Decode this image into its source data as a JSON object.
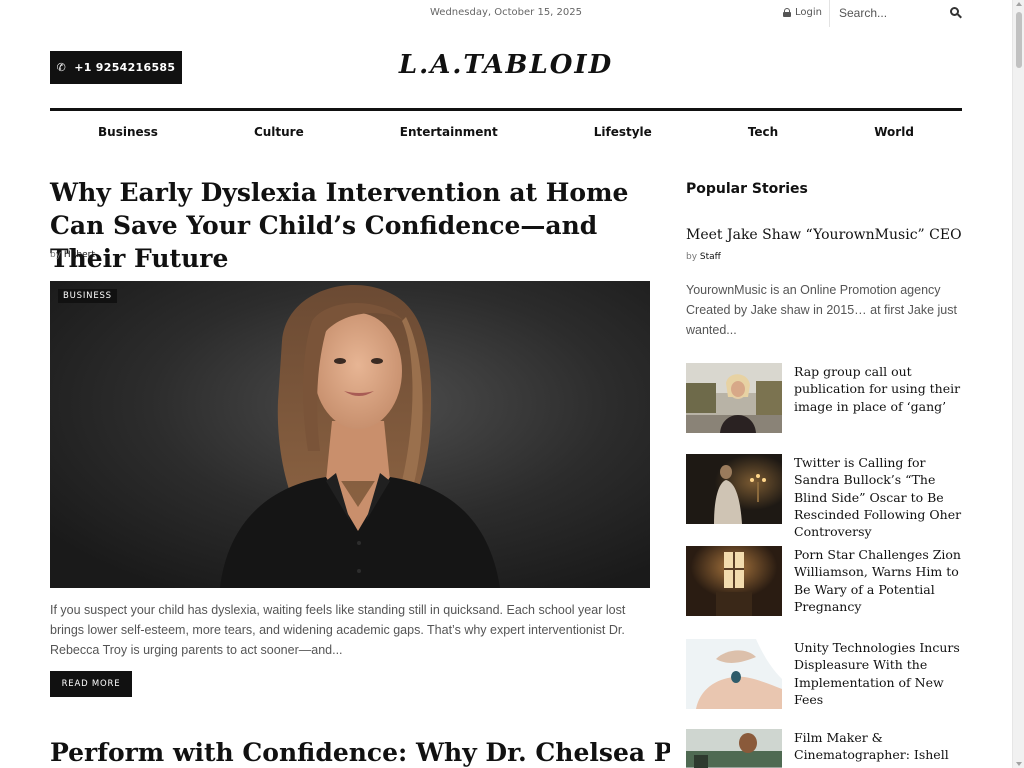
{
  "topbar": {
    "date": "Wednesday, October 15, 2025",
    "login_label": "Login",
    "search_placeholder": "Search..."
  },
  "header": {
    "phone_label": "+1 9254216585",
    "logo_text": "L.A.TABLOID"
  },
  "nav": {
    "items": [
      "Business",
      "Culture",
      "Entertainment",
      "Lifestyle",
      "Tech",
      "World"
    ]
  },
  "main": {
    "article": {
      "title": "Why Early Dyslexia Intervention at Home Can Save Your Child’s Confidence—and Their Future",
      "by_prefix": "by",
      "author": "Hubert",
      "category": "BUSINESS",
      "excerpt": "If you suspect your child has dyslexia, waiting feels like standing still in quicksand. Each school year lost brings lower self-esteem, more tears, and widening academic gaps. That’s why expert interventionist Dr. Rebecca Troy is urging parents to act sooner—and...",
      "read_more": "READ MORE"
    },
    "next_article_title": "Perform with Confidence: Why Dr. Chelsea Pierotti’s"
  },
  "sidebar": {
    "title": "Popular Stories",
    "featured": {
      "title": "Meet Jake Shaw “YourownMusic” CEO",
      "by_prefix": "by",
      "author": "Staff",
      "excerpt": "YourownMusic is an Online Promotion agency Created by Jake shaw in 2015… at first Jake just wanted..."
    },
    "stories": [
      {
        "title": "Rap group call out publication for using their image in place of ‘gang’"
      },
      {
        "title": "Twitter is Calling for Sandra Bullock’s “The Blind Side” Oscar to Be Rescinded Following Oher Controversy"
      },
      {
        "title": "Porn Star Challenges Zion Williamson, Warns Him to Be Wary of a Potential Pregnancy"
      },
      {
        "title": "Unity Technologies Incurs Displeasure With the Implementation of New Fees"
      },
      {
        "title": "Film Maker & Cinematographer: Ishell Newton Full Story"
      }
    ]
  },
  "colors": {
    "text": "#111111",
    "muted": "#555555",
    "button_bg": "#111111",
    "button_fg": "#ffffff"
  }
}
